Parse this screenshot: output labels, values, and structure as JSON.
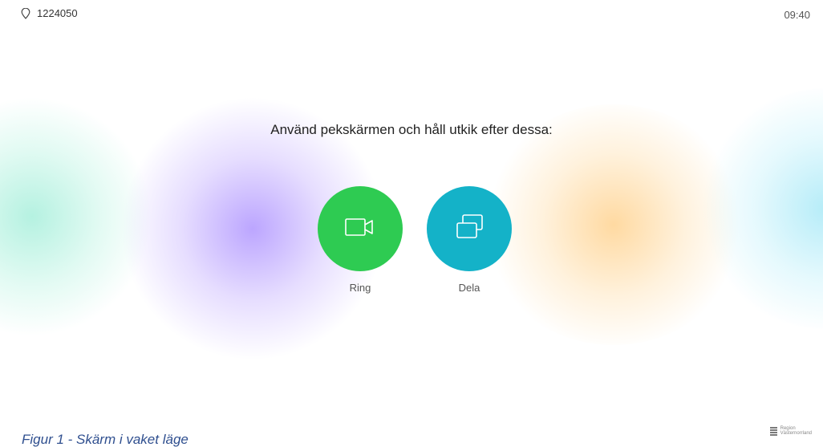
{
  "status_bar": {
    "location_icon": "map-pin-icon",
    "device_id": "1224050",
    "time": "09:40"
  },
  "main": {
    "instruction": "Använd pekskärmen och håll utkik efter dessa:",
    "actions": [
      {
        "label": "Ring",
        "icon": "video-camera-icon",
        "color": "#2ecb52"
      },
      {
        "label": "Dela",
        "icon": "share-screen-icon",
        "color": "#14b2c8"
      }
    ]
  },
  "caption": "Figur 1 - Skärm i vaket läge",
  "logo": {
    "line1": "Region",
    "line2": "Västernorrland"
  }
}
